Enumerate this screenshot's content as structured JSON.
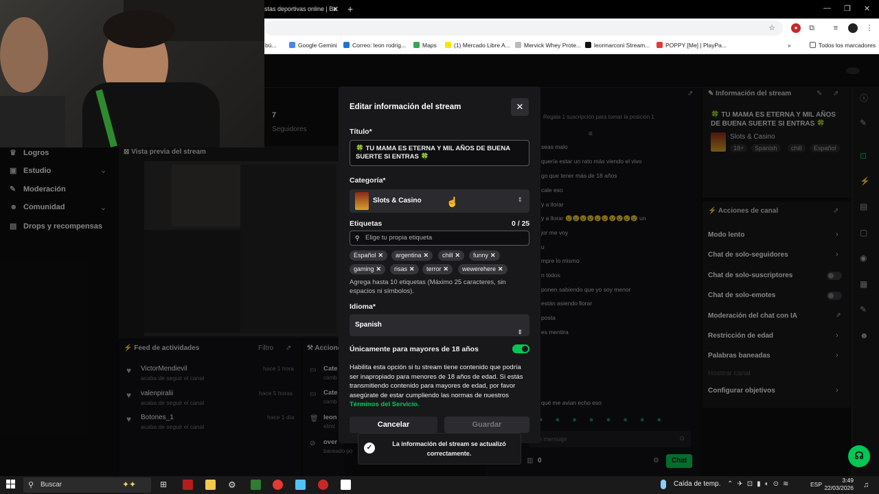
{
  "browser": {
    "tab_title": "stas deportivas online | Be",
    "bookmarks": [
      "bú...",
      "Google Gemini",
      "Correo: leon rodrig...",
      "Maps",
      "(1) Mercado Libre A...",
      "Mervick Whey Prote...",
      "leormarconi Stream...",
      "POPPY [Me] | PlayPa...",
      "Todos los marcadores"
    ]
  },
  "sidenav": {
    "items": [
      "Logros",
      "Estudio",
      "Moderación",
      "Comunidad",
      "Drops y recompensas"
    ]
  },
  "dashboard": {
    "followers_count": "7",
    "followers_label": "Seguidores",
    "preview_title": "Vista previa del stream",
    "activity_title": "Feed de actividades",
    "activity_filter": "Filtro",
    "actions_title": "Accione",
    "activity": [
      {
        "name": "VictorMendievil",
        "sub": "acaba de seguir el canal",
        "time": "hace 1 hora"
      },
      {
        "name": "valenpiralii",
        "sub": "acaba de seguir el canal",
        "time": "hace 5 horas"
      },
      {
        "name": "Botones_1",
        "sub": "acaba de seguir el canal",
        "time": "hace 1 día"
      }
    ],
    "actions_rows": [
      "Cate",
      "camb",
      "Cate",
      "camb",
      "leon",
      "elimi",
      "over",
      "baneado po"
    ]
  },
  "chat": {
    "gift_banner": "Regala 1 suscripción para tomar la posición 1",
    "lines": [
      "seas malo",
      "quería estar un rato más viendo el vivo",
      "go que tener más de 18 años",
      "cale eso",
      "y a llorar",
      "y a llorar 😢😢😢😢😢😢😢😢😢😢 un",
      "jor me voy",
      "u",
      "mpre lo mismo",
      "n todos",
      "ponen sabiendo que yo soy menor",
      "están asiendo llorar",
      "posta",
      "es mentira",
      "qué me avian echo eso"
    ],
    "input_placeholder": "n mensaje",
    "points": "0",
    "send_label": "Chat"
  },
  "info_panel": {
    "title": "Información del stream",
    "stream_title": "🍀 TU MAMA ES ETERNA Y MIL AÑOS DE BUENA SUERTE SI ENTRAS 🍀",
    "category": "Slots & Casino",
    "tags": [
      "18+",
      "Spanish",
      "chill",
      "Español"
    ]
  },
  "channel_actions": {
    "title": "Acciones de canal",
    "rows": [
      "Modo lento",
      "Chat de solo-seguidores",
      "Chat de solo-suscriptores",
      "Chat de solo-emotes",
      "Moderación del chat con IA",
      "Restricción de edad",
      "Palabras baneadas",
      "Hostear canal",
      "Configurar objetivos"
    ]
  },
  "modal": {
    "title": "Editar información del stream",
    "close": "✕",
    "title_label": "Título*",
    "title_value": "🍀 TU MAMA ES ETERNA Y MIL AÑOS DE BUENA SUERTE SI ENTRAS 🍀",
    "category_label": "Categoría*",
    "category_value": "Slots & Casino",
    "tags_label": "Etiquetas",
    "tags_count": "0 / 25",
    "tags_placeholder": "Elige tu propia etiqueta",
    "tags": [
      "Español",
      "argentina",
      "chill",
      "funny",
      "gaming",
      "risas",
      "terror",
      "wewerehere"
    ],
    "tags_hint": "Agrega hasta 10 etiquetas (Máximo 25 caracteres, sin espacios ni símbolos).",
    "language_label": "Idioma*",
    "language_value": "Spanish",
    "adult_label": "Únicamente para mayores de 18 años",
    "adult_enabled": true,
    "adult_desc": "Habilita esta opción si tu stream tiene contenido que podría ser inapropiado para menores de 18 años de edad. Si estás transmitiendo contenido para mayores de edad, por favor asegúrate de estar cumpliendo las normas de nuestros",
    "terms_link": "Términos del Servicio.",
    "cancel": "Cancelar",
    "save": "Guardar"
  },
  "toast": {
    "message": "La información del stream se actualizó correctamente."
  },
  "taskbar": {
    "search": "Buscar",
    "weather": "Caída de temp.",
    "lang": "ESP",
    "time": "3:49",
    "date": "22/03/2026"
  },
  "colors": {
    "accent": "#00c853",
    "modal_bg": "#18181b",
    "page_bg": "#0e0e10"
  }
}
